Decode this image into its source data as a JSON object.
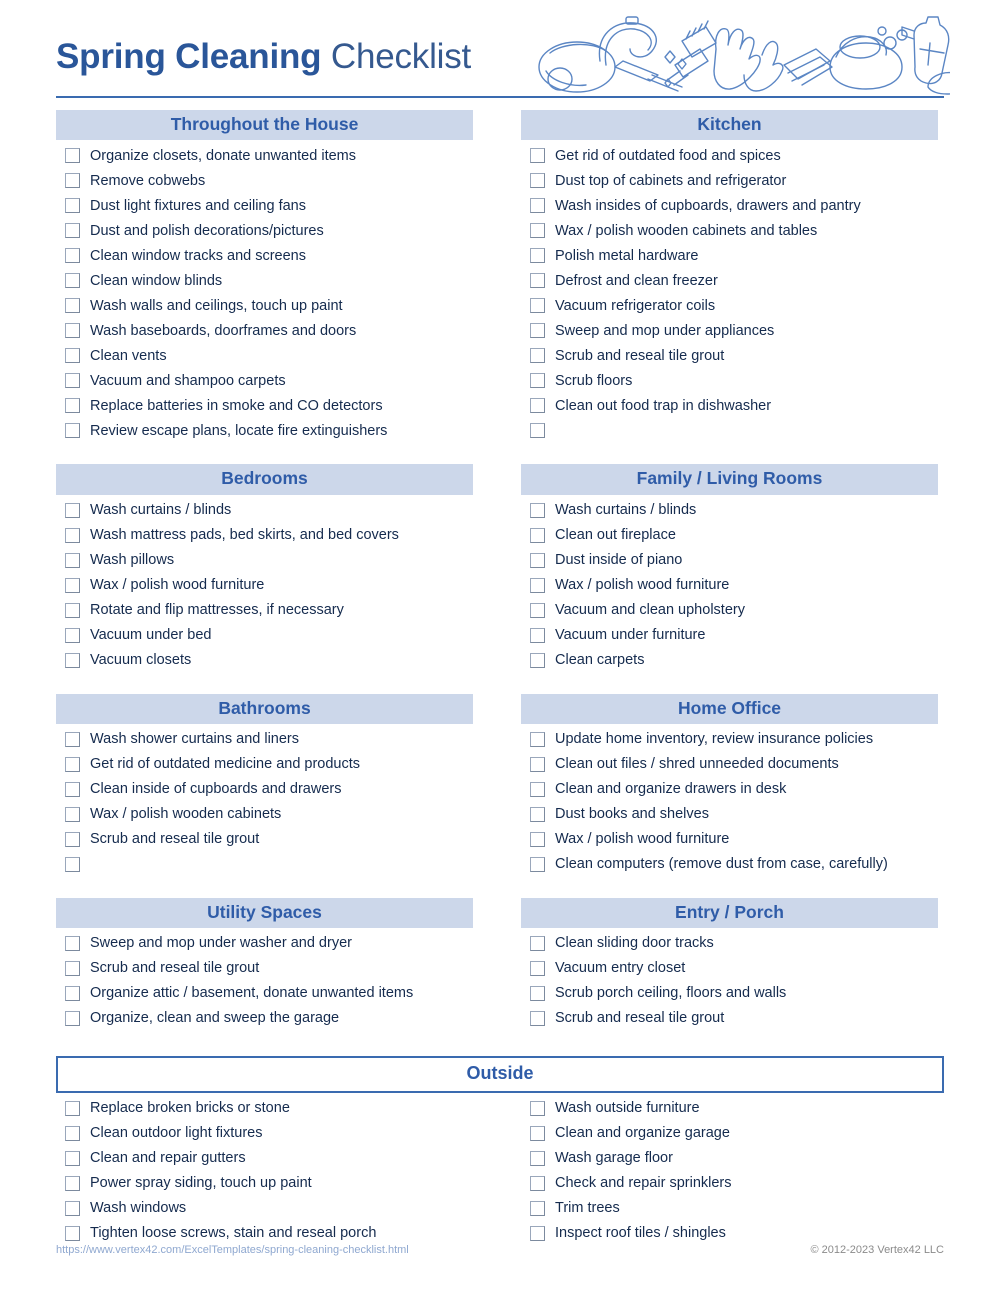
{
  "title": {
    "strong": "Spring Cleaning",
    "light": "Checklist"
  },
  "art": {
    "name": "cleaning-supplies-illustration"
  },
  "colors": {
    "heading_text": "#2f5ca8",
    "heading_bar": "#ccd7ea",
    "rule": "#3a6bb0",
    "body_text": "#152b4e",
    "checkbox_border": "#9aa7bb",
    "footer_url": "#8fa8d0",
    "footer_copy": "#8b8b8b"
  },
  "sections": [
    {
      "title": "Throughout the House",
      "column": "left",
      "items": [
        "Organize closets, donate unwanted items",
        "Remove cobwebs",
        "Dust light fixtures and ceiling fans",
        "Dust and polish decorations/pictures",
        "Clean window tracks and screens",
        "Clean window blinds",
        "Wash walls and ceilings, touch up paint",
        "Wash baseboards, doorframes and doors",
        "Clean vents",
        "Vacuum and shampoo carpets",
        "Replace batteries in smoke and CO detectors",
        "Review escape plans, locate fire extinguishers"
      ]
    },
    {
      "title": "Kitchen",
      "column": "right",
      "items": [
        "Get rid of outdated food and spices",
        "Dust top of cabinets and refrigerator",
        "Wash insides of cupboards, drawers and pantry",
        "Wax / polish wooden cabinets and tables",
        "Polish metal hardware",
        "Defrost and clean freezer",
        "Vacuum refrigerator coils",
        "Sweep and mop under appliances",
        "Scrub and reseal tile grout",
        "Scrub floors",
        "Clean out food trap in dishwasher",
        ""
      ]
    },
    {
      "title": "Bedrooms",
      "column": "left",
      "items": [
        "Wash curtains / blinds",
        "Wash mattress pads, bed skirts, and bed covers",
        "Wash pillows",
        "Wax / polish wood furniture",
        "Rotate and flip mattresses, if necessary",
        "Vacuum under bed",
        "Vacuum closets"
      ]
    },
    {
      "title": "Family / Living Rooms",
      "column": "right",
      "items": [
        "Wash curtains / blinds",
        "Clean out fireplace",
        "Dust inside of piano",
        "Wax / polish wood furniture",
        "Vacuum and clean upholstery",
        "Vacuum under furniture",
        "Clean carpets"
      ]
    },
    {
      "title": "Bathrooms",
      "column": "left",
      "items": [
        "Wash shower curtains and liners",
        "Get rid of outdated medicine and products",
        "Clean inside of cupboards and drawers",
        "Wax / polish wooden cabinets",
        "Scrub and reseal tile grout",
        ""
      ]
    },
    {
      "title": "Home Office",
      "column": "right",
      "items": [
        "Update home inventory, review insurance policies",
        "Clean out files / shred unneeded documents",
        "Clean and organize drawers in desk",
        "Dust books and shelves",
        "Wax / polish wood furniture",
        "Clean computers (remove dust from case, carefully)"
      ]
    },
    {
      "title": "Utility Spaces",
      "column": "left",
      "items": [
        "Sweep and mop under washer and dryer",
        "Scrub and reseal tile grout",
        "Organize attic / basement, donate unwanted items",
        "Organize, clean and sweep the garage"
      ]
    },
    {
      "title": "Entry / Porch",
      "column": "right",
      "items": [
        "Clean sliding door tracks",
        "Vacuum entry closet",
        "Scrub porch ceiling, floors and walls",
        "Scrub and reseal tile grout"
      ]
    }
  ],
  "outside": {
    "title": "Outside",
    "left_items": [
      "Replace broken bricks or stone",
      "Clean outdoor light fixtures",
      "Clean and repair gutters",
      "Power spray siding, touch up paint",
      "Wash windows",
      "Tighten loose screws, stain and reseal porch"
    ],
    "right_items": [
      "Wash outside furniture",
      "Clean and organize garage",
      "Wash garage floor",
      "Check and repair sprinklers",
      "Trim trees",
      "Inspect roof tiles / shingles"
    ]
  },
  "footer": {
    "url": "https://www.vertex42.com/ExcelTemplates/spring-cleaning-checklist.html",
    "copyright": "© 2012-2023 Vertex42 LLC"
  }
}
